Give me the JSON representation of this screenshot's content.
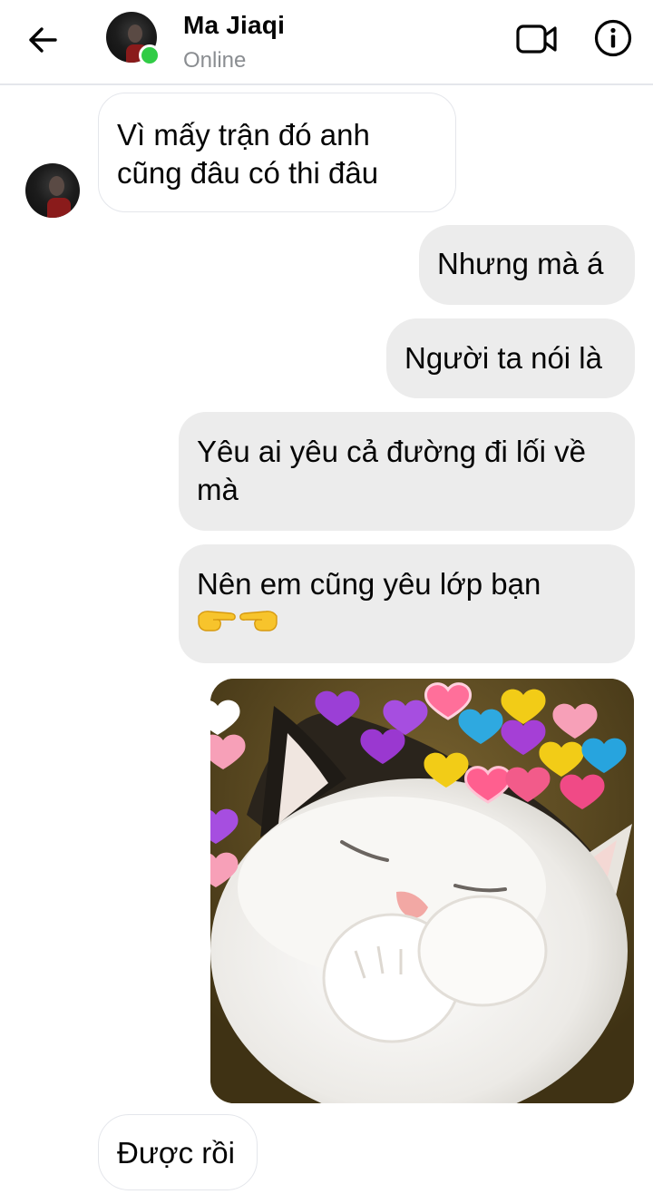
{
  "header": {
    "contact_name": "Ma Jiaqi",
    "status": "Online",
    "back_icon": "arrow-left-icon",
    "video_icon": "video-camera-icon",
    "info_icon": "info-icon"
  },
  "colors": {
    "online": "#31cc46",
    "incoming_bubble": "#ffffff",
    "outgoing_bubble": "#ececec",
    "status_text": "#8a8d91"
  },
  "messages": [
    {
      "direction": "incoming",
      "text_line1": "Vì mấy trận đó anh",
      "text_line2": "cũng đâu có thi đâu"
    },
    {
      "direction": "outgoing",
      "text": "Nhưng mà á"
    },
    {
      "direction": "outgoing",
      "text": "Người ta nói là"
    },
    {
      "direction": "outgoing",
      "text_line1": "Yêu ai yêu cả đường đi lối về",
      "text_line2": "mà"
    },
    {
      "direction": "outgoing",
      "text_line1": "Nên em cũng yêu lớp bạn",
      "emojis": "👉👈"
    },
    {
      "direction": "outgoing",
      "type": "sticker",
      "sticker": "white-cat-with-hearts-sticker"
    },
    {
      "direction": "incoming",
      "text": "Được rồi"
    }
  ]
}
